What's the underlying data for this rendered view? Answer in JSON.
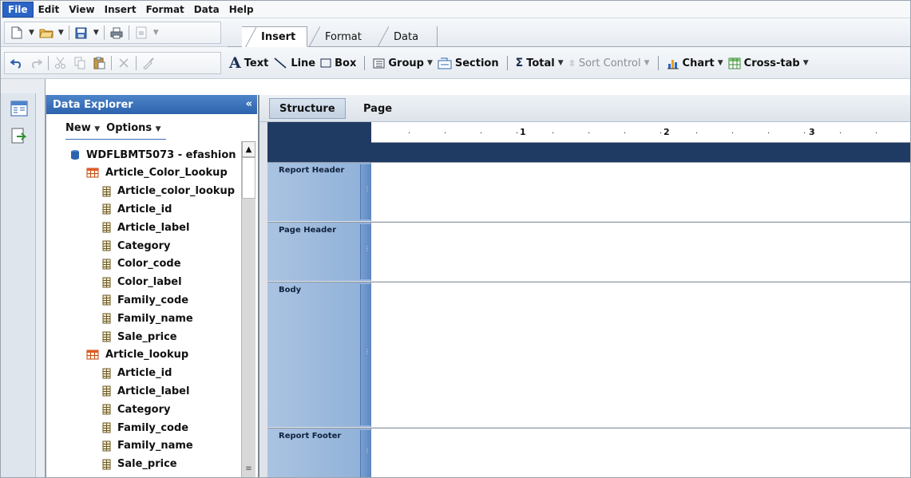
{
  "menubar": {
    "items": [
      "File",
      "Edit",
      "View",
      "Insert",
      "Format",
      "Data",
      "Help"
    ]
  },
  "toolbar": {
    "tabs": [
      "Insert",
      "Format",
      "Data"
    ],
    "insert_items": {
      "text": "Text",
      "line": "Line",
      "box": "Box",
      "group": "Group",
      "section": "Section",
      "total": "Total",
      "sort_control": "Sort Control",
      "chart": "Chart",
      "crosstab": "Cross-tab"
    }
  },
  "explorer": {
    "title": "Data Explorer",
    "collapse_glyph": "«",
    "menu": {
      "new": "New",
      "options": "Options"
    },
    "tree": [
      {
        "label": "WDFLBMT5073 - efashion",
        "type": "database",
        "level": 0
      },
      {
        "label": "Article_Color_Lookup",
        "type": "table",
        "level": 1
      },
      {
        "label": "Article_color_lookup",
        "type": "field",
        "level": 2
      },
      {
        "label": "Article_id",
        "type": "field",
        "level": 2
      },
      {
        "label": "Article_label",
        "type": "field",
        "level": 2
      },
      {
        "label": "Category",
        "type": "field",
        "level": 2
      },
      {
        "label": "Color_code",
        "type": "field",
        "level": 2
      },
      {
        "label": "Color_label",
        "type": "field",
        "level": 2
      },
      {
        "label": "Family_code",
        "type": "field",
        "level": 2
      },
      {
        "label": "Family_name",
        "type": "field",
        "level": 2
      },
      {
        "label": "Sale_price",
        "type": "field",
        "level": 2
      },
      {
        "label": "Article_lookup",
        "type": "table",
        "level": 1
      },
      {
        "label": "Article_id",
        "type": "field",
        "level": 2
      },
      {
        "label": "Article_label",
        "type": "field",
        "level": 2
      },
      {
        "label": "Category",
        "type": "field",
        "level": 2
      },
      {
        "label": "Family_code",
        "type": "field",
        "level": 2
      },
      {
        "label": "Family_name",
        "type": "field",
        "level": 2
      },
      {
        "label": "Sale_price",
        "type": "field",
        "level": 2
      }
    ]
  },
  "report": {
    "view_tabs": {
      "structure": "Structure",
      "page": "Page"
    },
    "ruler_numbers": [
      "1",
      "2",
      "3"
    ],
    "sections": [
      "Report Header",
      "Page Header",
      "Body",
      "Report Footer"
    ]
  },
  "colors": {
    "accent": "#2d63ad",
    "ruler_band": "#1f3a63",
    "section_label": "#9ab8dd"
  }
}
